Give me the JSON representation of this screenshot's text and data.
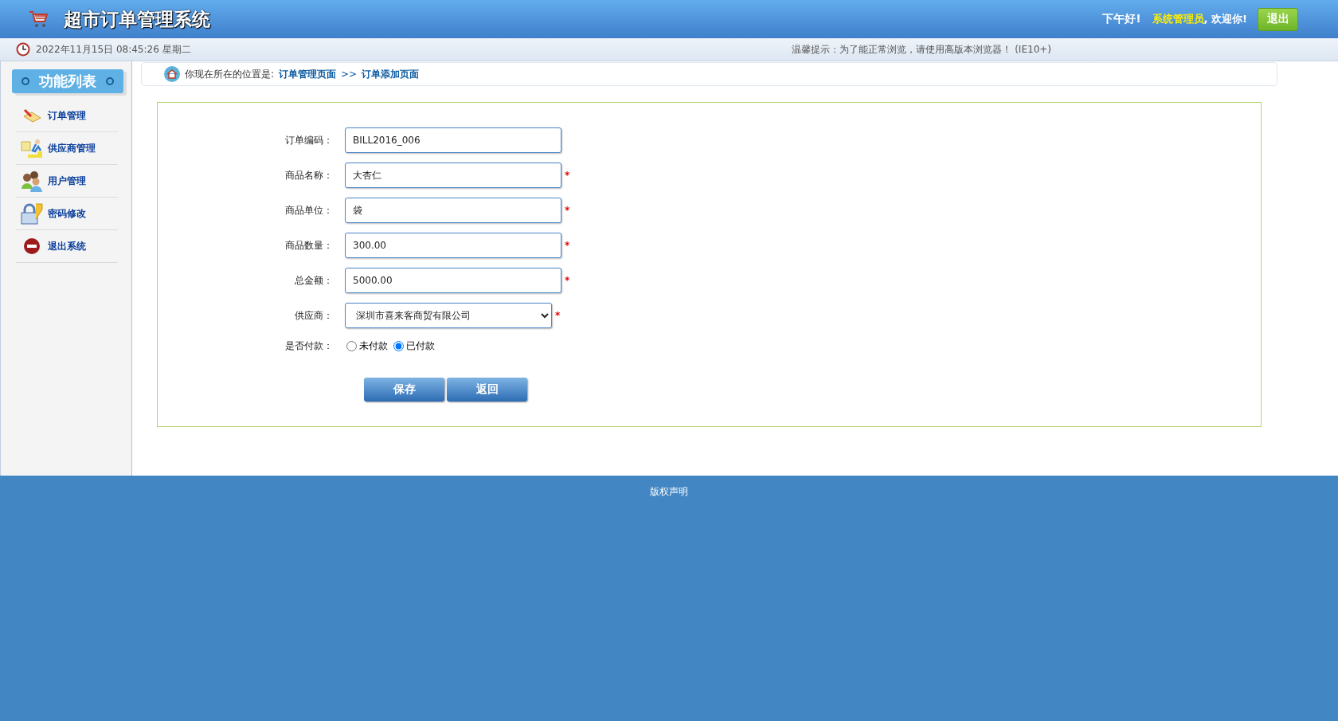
{
  "header": {
    "title": "超市订单管理系统",
    "greeting": "下午好!",
    "user": "系统管理员",
    "welcome": ", 欢迎你!",
    "logout": "退出"
  },
  "info_bar": {
    "datetime": "2022年11月15日 08:45:26 星期二",
    "notice": "温馨提示：为了能正常浏览，请使用高版本浏览器！ (IE10+)"
  },
  "sidebar": {
    "title": "功能列表",
    "items": [
      {
        "label": "订单管理",
        "kind": "order"
      },
      {
        "label": "供应商管理",
        "kind": "supplier"
      },
      {
        "label": "用户管理",
        "kind": "user"
      },
      {
        "label": "密码修改",
        "kind": "password"
      },
      {
        "label": "退出系统",
        "kind": "exit"
      }
    ]
  },
  "breadcrumb": {
    "prefix": "你现在所在的位置是:",
    "links": [
      "订单管理页面",
      "订单添加页面"
    ],
    "separator": ">>"
  },
  "form": {
    "fields": [
      {
        "kind": "text",
        "label": "订单编码：",
        "value": "BILL2016_006"
      },
      {
        "kind": "text",
        "label": "商品名称：",
        "value": "大杏仁",
        "mark": "*"
      },
      {
        "kind": "text",
        "label": "商品单位：",
        "value": "袋",
        "mark": "*"
      },
      {
        "kind": "text",
        "label": "商品数量：",
        "value": "300.00",
        "mark": "*"
      },
      {
        "kind": "text",
        "label": "总金额：",
        "value": "5000.00",
        "mark": "*"
      },
      {
        "kind": "select",
        "label": "供应商：",
        "value": "深圳市喜来客商贸有限公司",
        "mark": "*"
      },
      {
        "kind": "radio",
        "label": "是否付款：",
        "options": [
          {
            "label": "未付款",
            "selected": false
          },
          {
            "label": "已付款",
            "selected": true
          }
        ]
      }
    ],
    "buttons": [
      "保存",
      "返回"
    ]
  },
  "footer": {
    "text": "版权声明"
  }
}
